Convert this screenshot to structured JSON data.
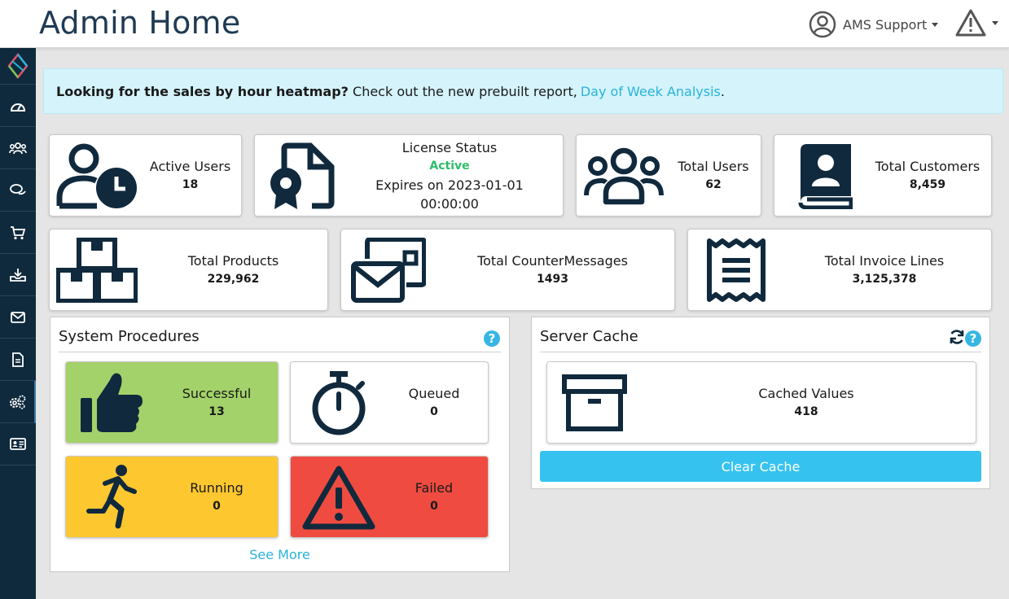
{
  "header": {
    "title": "Admin Home",
    "user_name": "AMS Support",
    "user_icon": "user-circle-icon",
    "alert_icon": "warning-triangle-icon"
  },
  "sidebar": {
    "items": [
      {
        "icon": "dashboard-icon"
      },
      {
        "icon": "users-group-icon"
      },
      {
        "icon": "chat-bubbles-icon"
      },
      {
        "icon": "cart-icon"
      },
      {
        "icon": "inbox-download-icon"
      },
      {
        "icon": "envelope-icon"
      },
      {
        "icon": "document-icon"
      },
      {
        "icon": "gears-icon"
      },
      {
        "icon": "id-card-icon"
      }
    ]
  },
  "banner": {
    "bold_text": "Looking for the sales by hour heatmap?",
    "text": "Check out the new prebuilt report,",
    "link_text": "Day of Week Analysis",
    "suffix": "."
  },
  "stats": {
    "active_users": {
      "label": "Active Users",
      "value": "18"
    },
    "license": {
      "label": "License Status",
      "status": "Active",
      "expires": "Expires on 2023-01-01 00:00:00"
    },
    "total_users": {
      "label": "Total Users",
      "value": "62"
    },
    "total_customers": {
      "label": "Total Customers",
      "value": "8,459"
    },
    "total_products": {
      "label": "Total Products",
      "value": "229,962"
    },
    "total_counter_messages": {
      "label": "Total CounterMessages",
      "value": "1493"
    },
    "total_invoice_lines": {
      "label": "Total Invoice Lines",
      "value": "3,125,378"
    }
  },
  "system_procedures": {
    "title": "System Procedures",
    "successful": {
      "label": "Successful",
      "value": "13"
    },
    "queued": {
      "label": "Queued",
      "value": "0"
    },
    "running": {
      "label": "Running",
      "value": "0"
    },
    "failed": {
      "label": "Failed",
      "value": "0"
    },
    "see_more": "See More"
  },
  "server_cache": {
    "title": "Server Cache",
    "cached_values": {
      "label": "Cached Values",
      "value": "418"
    },
    "clear_button": "Clear Cache"
  },
  "help_glyph": "?",
  "colors": {
    "navy": "#1f3a53",
    "sidebar": "#0f2a3c",
    "accent": "#36c2ef",
    "success": "#a3d26a",
    "warning": "#fdc72f",
    "danger": "#ef4b40",
    "active_green": "#2ebd6b"
  }
}
